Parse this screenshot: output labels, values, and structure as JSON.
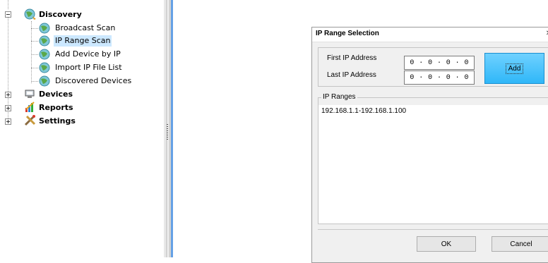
{
  "tree": {
    "discovery": {
      "label": "Discovery",
      "children": [
        {
          "label": "Broadcast Scan"
        },
        {
          "label": "IP Range Scan"
        },
        {
          "label": "Add Device by IP"
        },
        {
          "label": "Import IP File List"
        },
        {
          "label": "Discovered Devices"
        }
      ]
    },
    "devices": {
      "label": "Devices"
    },
    "reports": {
      "label": "Reports"
    },
    "settings": {
      "label": "Settings"
    }
  },
  "dialog": {
    "title": "IP Range Selection",
    "close_glyph": "✕",
    "first_ip_label": "First IP Address",
    "last_ip_label": "Last IP Address",
    "first_ip": [
      "0",
      "0",
      "0",
      "0"
    ],
    "last_ip": [
      "0",
      "0",
      "0",
      "0"
    ],
    "ip_separator": "·",
    "add_label": "Add",
    "ranges_legend": "IP Ranges",
    "ranges": [
      "192.168.1.1-192.168.1.100"
    ],
    "ok_label": "OK",
    "cancel_label": "Cancel"
  },
  "icons": {
    "discovery": "globe-icon",
    "devices": "devices-icon",
    "reports": "reports-icon",
    "settings": "settings-icon"
  },
  "colors": {
    "selected_bg": "#cce8ff",
    "add_button": "#2fb7f8",
    "splitter_accent": "#4a90e2"
  }
}
